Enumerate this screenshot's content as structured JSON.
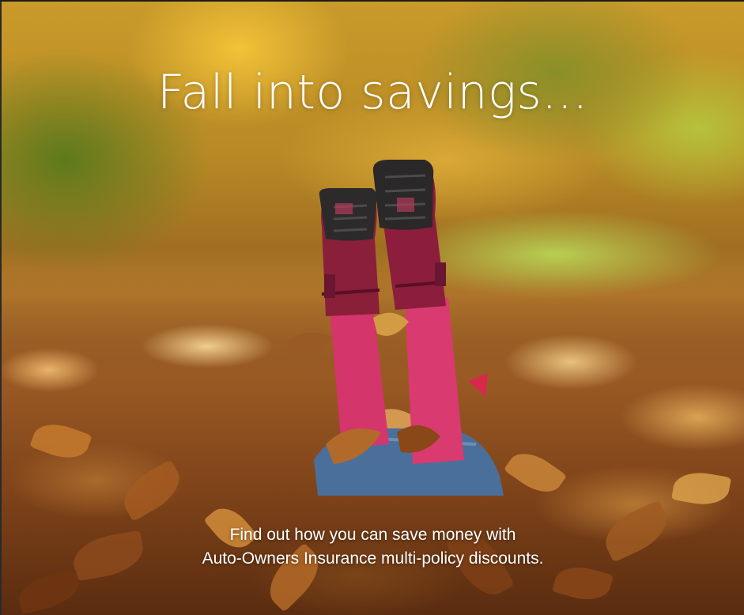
{
  "ad": {
    "headline": "Fall into savings...",
    "subline_1": "Find out how you can save money with",
    "subline_2": "Auto-Owners Insurance multi-policy discounts."
  },
  "image": {
    "scene": "child-in-autumn-leaves-photo"
  }
}
